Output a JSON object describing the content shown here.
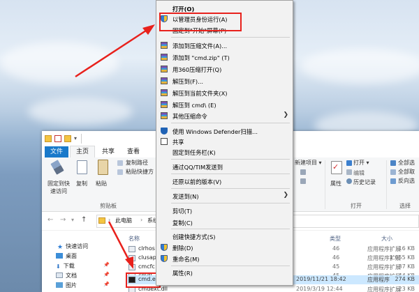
{
  "context_menu": {
    "items": [
      {
        "label": "打开(O)",
        "icon": "none",
        "bold": true
      },
      {
        "label": "以管理员身份运行(A)",
        "icon": "uac-shield-icon"
      },
      {
        "label": "固定到\"开始\"屏幕(P)",
        "icon": "none"
      },
      {
        "label": "添加到压缩文件(A)...",
        "icon": "winrar-icon"
      },
      {
        "label": "添加到 \"cmd.zip\" (T)",
        "icon": "winrar-icon"
      },
      {
        "label": "用360压缩打开(Q)",
        "icon": "winrar-icon"
      },
      {
        "label": "解压到(F)...",
        "icon": "winrar-icon"
      },
      {
        "label": "解压到当前文件夹(X)",
        "icon": "winrar-icon"
      },
      {
        "label": "解压到 cmd\\ (E)",
        "icon": "winrar-icon"
      },
      {
        "label": "其他压缩命令",
        "icon": "winrar-icon",
        "submenu": true
      },
      {
        "label": "使用 Windows Defender扫描...",
        "icon": "defender-icon"
      },
      {
        "label": "共享",
        "icon": "share-icon"
      },
      {
        "label": "固定到任务栏(K)",
        "icon": "none"
      },
      {
        "label": "通过QQ/TIM发送到",
        "icon": "none"
      },
      {
        "label": "还原以前的版本(V)",
        "icon": "none"
      },
      {
        "label": "发送到(N)",
        "icon": "none",
        "submenu": true
      },
      {
        "label": "剪切(T)",
        "icon": "none"
      },
      {
        "label": "复制(C)",
        "icon": "none"
      },
      {
        "label": "创建快捷方式(S)",
        "icon": "none"
      },
      {
        "label": "删除(D)",
        "icon": "uac-shield-icon"
      },
      {
        "label": "重命名(M)",
        "icon": "uac-shield-icon"
      },
      {
        "label": "属性(R)",
        "icon": "none"
      }
    ],
    "submenu_glyph": "❯"
  },
  "explorer": {
    "tabs": {
      "file": "文件",
      "home": "主页",
      "share": "共享",
      "view": "查看"
    },
    "ribbon": {
      "pin_quick_access": "固定到快速访问",
      "pin_line1": "固定到快",
      "pin_line2": "速访问",
      "copy": "复制",
      "paste": "粘贴",
      "copy_path": "复制路径",
      "paste_shortcut": "粘贴快捷方",
      "clipboard_group": "剪贴板",
      "new_item": "新建项目",
      "properties": "属性",
      "open": "打开",
      "edit": "编辑",
      "history": "历史记录",
      "open_group": "打开",
      "select_all": "全部选",
      "select_none": "全部取",
      "invert_selection": "反向选",
      "select_group": "选择"
    },
    "address": {
      "segments": [
        "此电脑",
        "系统"
      ],
      "sep": "›"
    },
    "nav": {
      "quick_access": "快速访问",
      "desktop": "桌面",
      "downloads": "下载",
      "documents": "文档",
      "pictures": "图片"
    },
    "columns": {
      "name": "名称",
      "type": "类型",
      "size": "大小"
    },
    "files": [
      {
        "name": "clrhos",
        "date": "46",
        "type": "应用程序扩展",
        "size": "16 KB"
      },
      {
        "name": "clusap",
        "date": "46",
        "type": "应用程序扩展",
        "size": "1,055 KB"
      },
      {
        "name": "cmcfc",
        "date": "45",
        "type": "应用程序扩展",
        "size": "37 KB"
      },
      {
        "name": "cmdl",
        "date": "45",
        "type": "应用程序扩展",
        "size": "44 KB"
      },
      {
        "name": "cmd.exe",
        "date": "2019/11/21 18:42",
        "type": "应用程序",
        "size": "274 KB",
        "selected": true
      },
      {
        "name": "cmdext.dll",
        "date": "2019/3/19 12:44",
        "type": "应用程序扩展",
        "size": "23 KB"
      }
    ]
  },
  "colors": {
    "annotation_red": "#e8211c",
    "accent_blue": "#1979ca",
    "selection": "#cce8ff"
  }
}
